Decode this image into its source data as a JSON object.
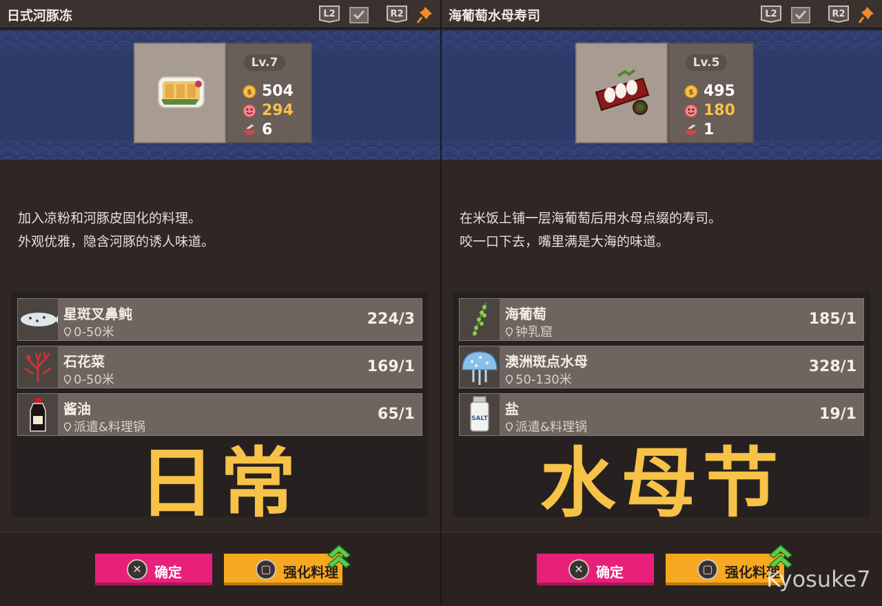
{
  "watermark": "Kyosuke7",
  "panels": [
    {
      "title": "日式河豚冻",
      "l2_label": "L2",
      "r2_label": "R2",
      "level": "Lv.7",
      "price": "504",
      "taste": "294",
      "count": "6",
      "description_line1": "加入凉粉和河豚皮固化的料理。",
      "description_line2": "外观优雅，隐含河豚的诱人味道。",
      "ingredients": [
        {
          "name": "星斑叉鼻鲀",
          "location": "0-50米",
          "quantity": "224/3",
          "icon": "pufferfish-icon"
        },
        {
          "name": "石花菜",
          "location": "0-50米",
          "quantity": "169/1",
          "icon": "red-seaweed-icon"
        },
        {
          "name": "酱油",
          "location": "派遣&料理锅",
          "quantity": "65/1",
          "icon": "soy-sauce-icon"
        }
      ],
      "event_label": "日常",
      "confirm_label": "确定",
      "upgrade_label": "强化料理",
      "colors": {
        "price": "#ffffff",
        "taste": "#f6c248",
        "count": "#ffffff"
      }
    },
    {
      "title": "海葡萄水母寿司",
      "l2_label": "L2",
      "r2_label": "R2",
      "level": "Lv.5",
      "price": "495",
      "taste": "180",
      "count": "1",
      "description_line1": "在米饭上铺一层海葡萄后用水母点缀的寿司。",
      "description_line2": "咬一口下去，嘴里满是大海的味道。",
      "ingredients": [
        {
          "name": "海葡萄",
          "location": "钟乳窟",
          "quantity": "185/1",
          "icon": "sea-grape-icon"
        },
        {
          "name": "澳洲斑点水母",
          "location": "50-130米",
          "quantity": "328/1",
          "icon": "jellyfish-icon"
        },
        {
          "name": "盐",
          "location": "派遣&料理锅",
          "quantity": "19/1",
          "icon": "salt-icon"
        }
      ],
      "event_label": "水母节",
      "confirm_label": "确定",
      "upgrade_label": "强化料理",
      "colors": {
        "price": "#ffffff",
        "taste": "#f6c248",
        "count": "#ffffff"
      }
    }
  ],
  "salt_label": "SALT"
}
